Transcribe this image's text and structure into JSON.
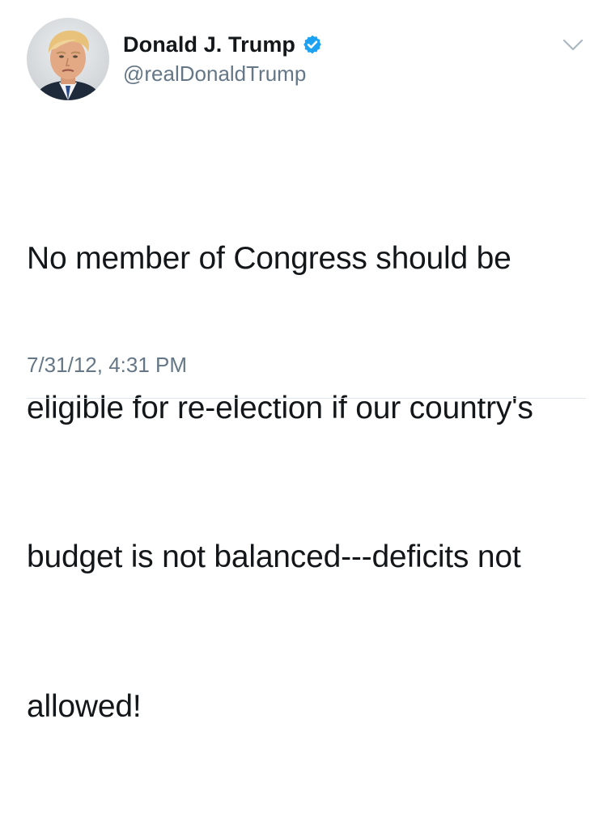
{
  "tweet": {
    "author": {
      "display_name": "Donald J. Trump",
      "handle": "@realDonaldTrump",
      "verified": true,
      "avatar_icon": "profile-photo",
      "verified_icon": "verified-badge-icon"
    },
    "text_lines": [
      "No member of Congress should be",
      "eligible for re-election if our country's",
      "budget is not balanced---deficits not",
      "allowed!"
    ],
    "timestamp": "7/31/12, 4:31 PM",
    "menu_icon": "chevron-down-icon"
  },
  "colors": {
    "primary_text": "#14171a",
    "secondary_text": "#657786",
    "verified_blue": "#1da1f2",
    "chevron": "#aab8c2",
    "divider": "#e1e8ed"
  }
}
